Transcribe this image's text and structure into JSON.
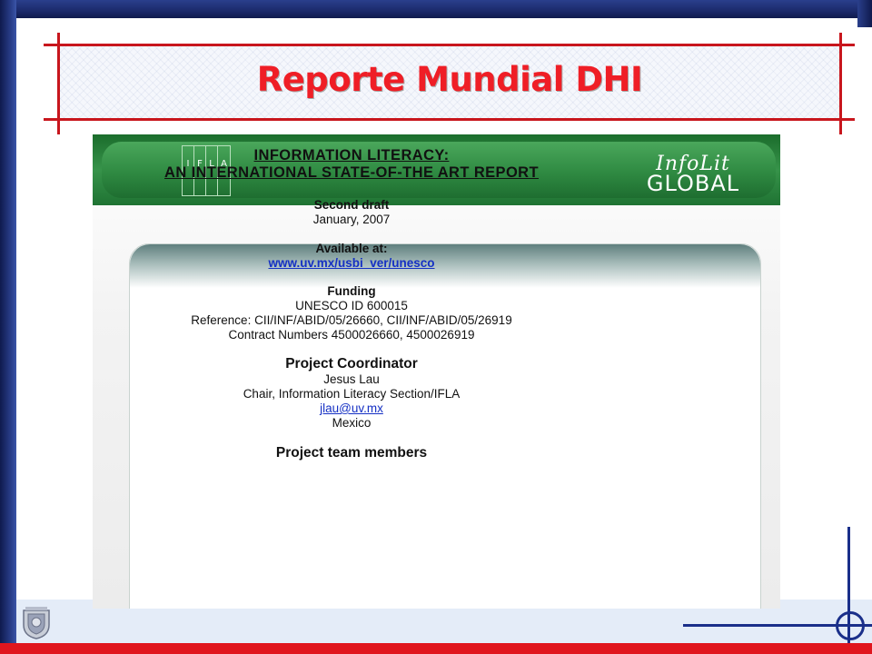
{
  "slide": {
    "title": "Reporte Mundial DHI"
  },
  "screenshot": {
    "header": {
      "ifla_letters": [
        "I",
        "F",
        "L",
        "A"
      ],
      "infolit_line1": "InfoLit",
      "infolit_line2": "GLOBAL"
    },
    "doc": {
      "title_line1": "INFORMATION LITERACY:",
      "title_line2": "AN INTERNATIONAL STATE-OF-THE ART REPORT",
      "draft_heading": "Second draft",
      "draft_date": "January, 2007",
      "available_heading": "Available at:",
      "available_url": "www.uv.mx/usbi_ver/unesco",
      "funding_heading": "Funding",
      "funding_id": "UNESCO ID 600015",
      "funding_reference": "Reference: CII/INF/ABID/05/26660, CII/INF/ABID/05/26919",
      "funding_contracts": "Contract Numbers 4500026660, 4500026919",
      "coordinator_heading": "Project Coordinator",
      "coordinator_name": "Jesus Lau",
      "coordinator_role": "Chair, Information Literacy Section/IFLA",
      "coordinator_email": "jlau@uv.mx",
      "coordinator_country": "Mexico",
      "team_heading": "Project team members"
    }
  },
  "colors": {
    "title_red": "#ef1e26",
    "frame_blue": "#1b2a6b",
    "header_green": "#2f8a42",
    "link_blue": "#1530c4"
  }
}
